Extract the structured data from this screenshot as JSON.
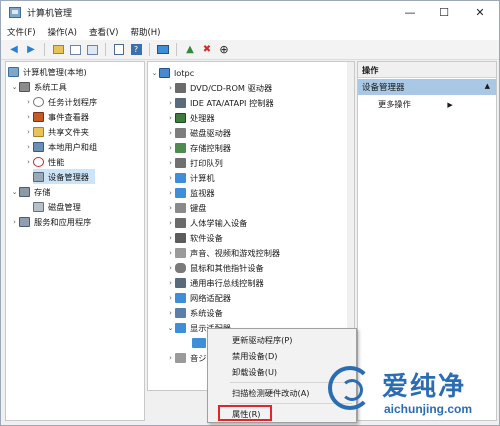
{
  "window": {
    "title": "计算机管理",
    "controls": {
      "minimize": "—",
      "maximize": "☐",
      "close": "✕"
    }
  },
  "menu": [
    "文件(F)",
    "操作(A)",
    "查看(V)",
    "帮助(H)"
  ],
  "toolbar": {
    "icons": [
      "back-icon",
      "forward-icon",
      "up-icon",
      "show-hide-tree-icon",
      "refresh-icon",
      "properties-icon",
      "help-icon",
      "monitor-icon",
      "update-driver-icon",
      "uninstall-icon",
      "scan-icon"
    ]
  },
  "tree": {
    "root": "计算机管理(本地)",
    "system_tools": "系统工具",
    "task_scheduler": "任务计划程序",
    "event_viewer": "事件查看器",
    "shared_folders": "共享文件夹",
    "local_users": "本地用户和组",
    "performance": "性能",
    "device_manager": "设备管理器",
    "storage": "存储",
    "disk_management": "磁盘管理",
    "services_apps": "服务和应用程序"
  },
  "devices": {
    "computer_name": "lotpc",
    "items": [
      "DVD/CD-ROM 驱动器",
      "IDE ATA/ATAPI 控制器",
      "处理器",
      "磁盘驱动器",
      "存储控制器",
      "打印队列",
      "计算机",
      "监视器",
      "键盘",
      "人体学输入设备",
      "软件设备",
      "声音、视频和游戏控制器",
      "鼠标和其他指针设备",
      "通用串行总线控制器",
      "网络适配器",
      "系统设备",
      "显示适配器"
    ],
    "audio_partial": "音ジ"
  },
  "actions": {
    "header": "操作",
    "section": "设备管理器",
    "more": "更多操作"
  },
  "context_menu": {
    "update_driver": "更新驱动程序(P)",
    "disable": "禁用设备(D)",
    "uninstall": "卸载设备(U)",
    "scan": "扫描检测硬件改动(A)",
    "properties": "属性(R)"
  },
  "watermark": {
    "brand": "爱纯净",
    "url": "aichunjing.com"
  },
  "colors": {
    "selection": "#cce4f7",
    "action_title": "#a9c8e6",
    "highlight_box": "#e0262b",
    "watermark": "#2b6db3"
  }
}
